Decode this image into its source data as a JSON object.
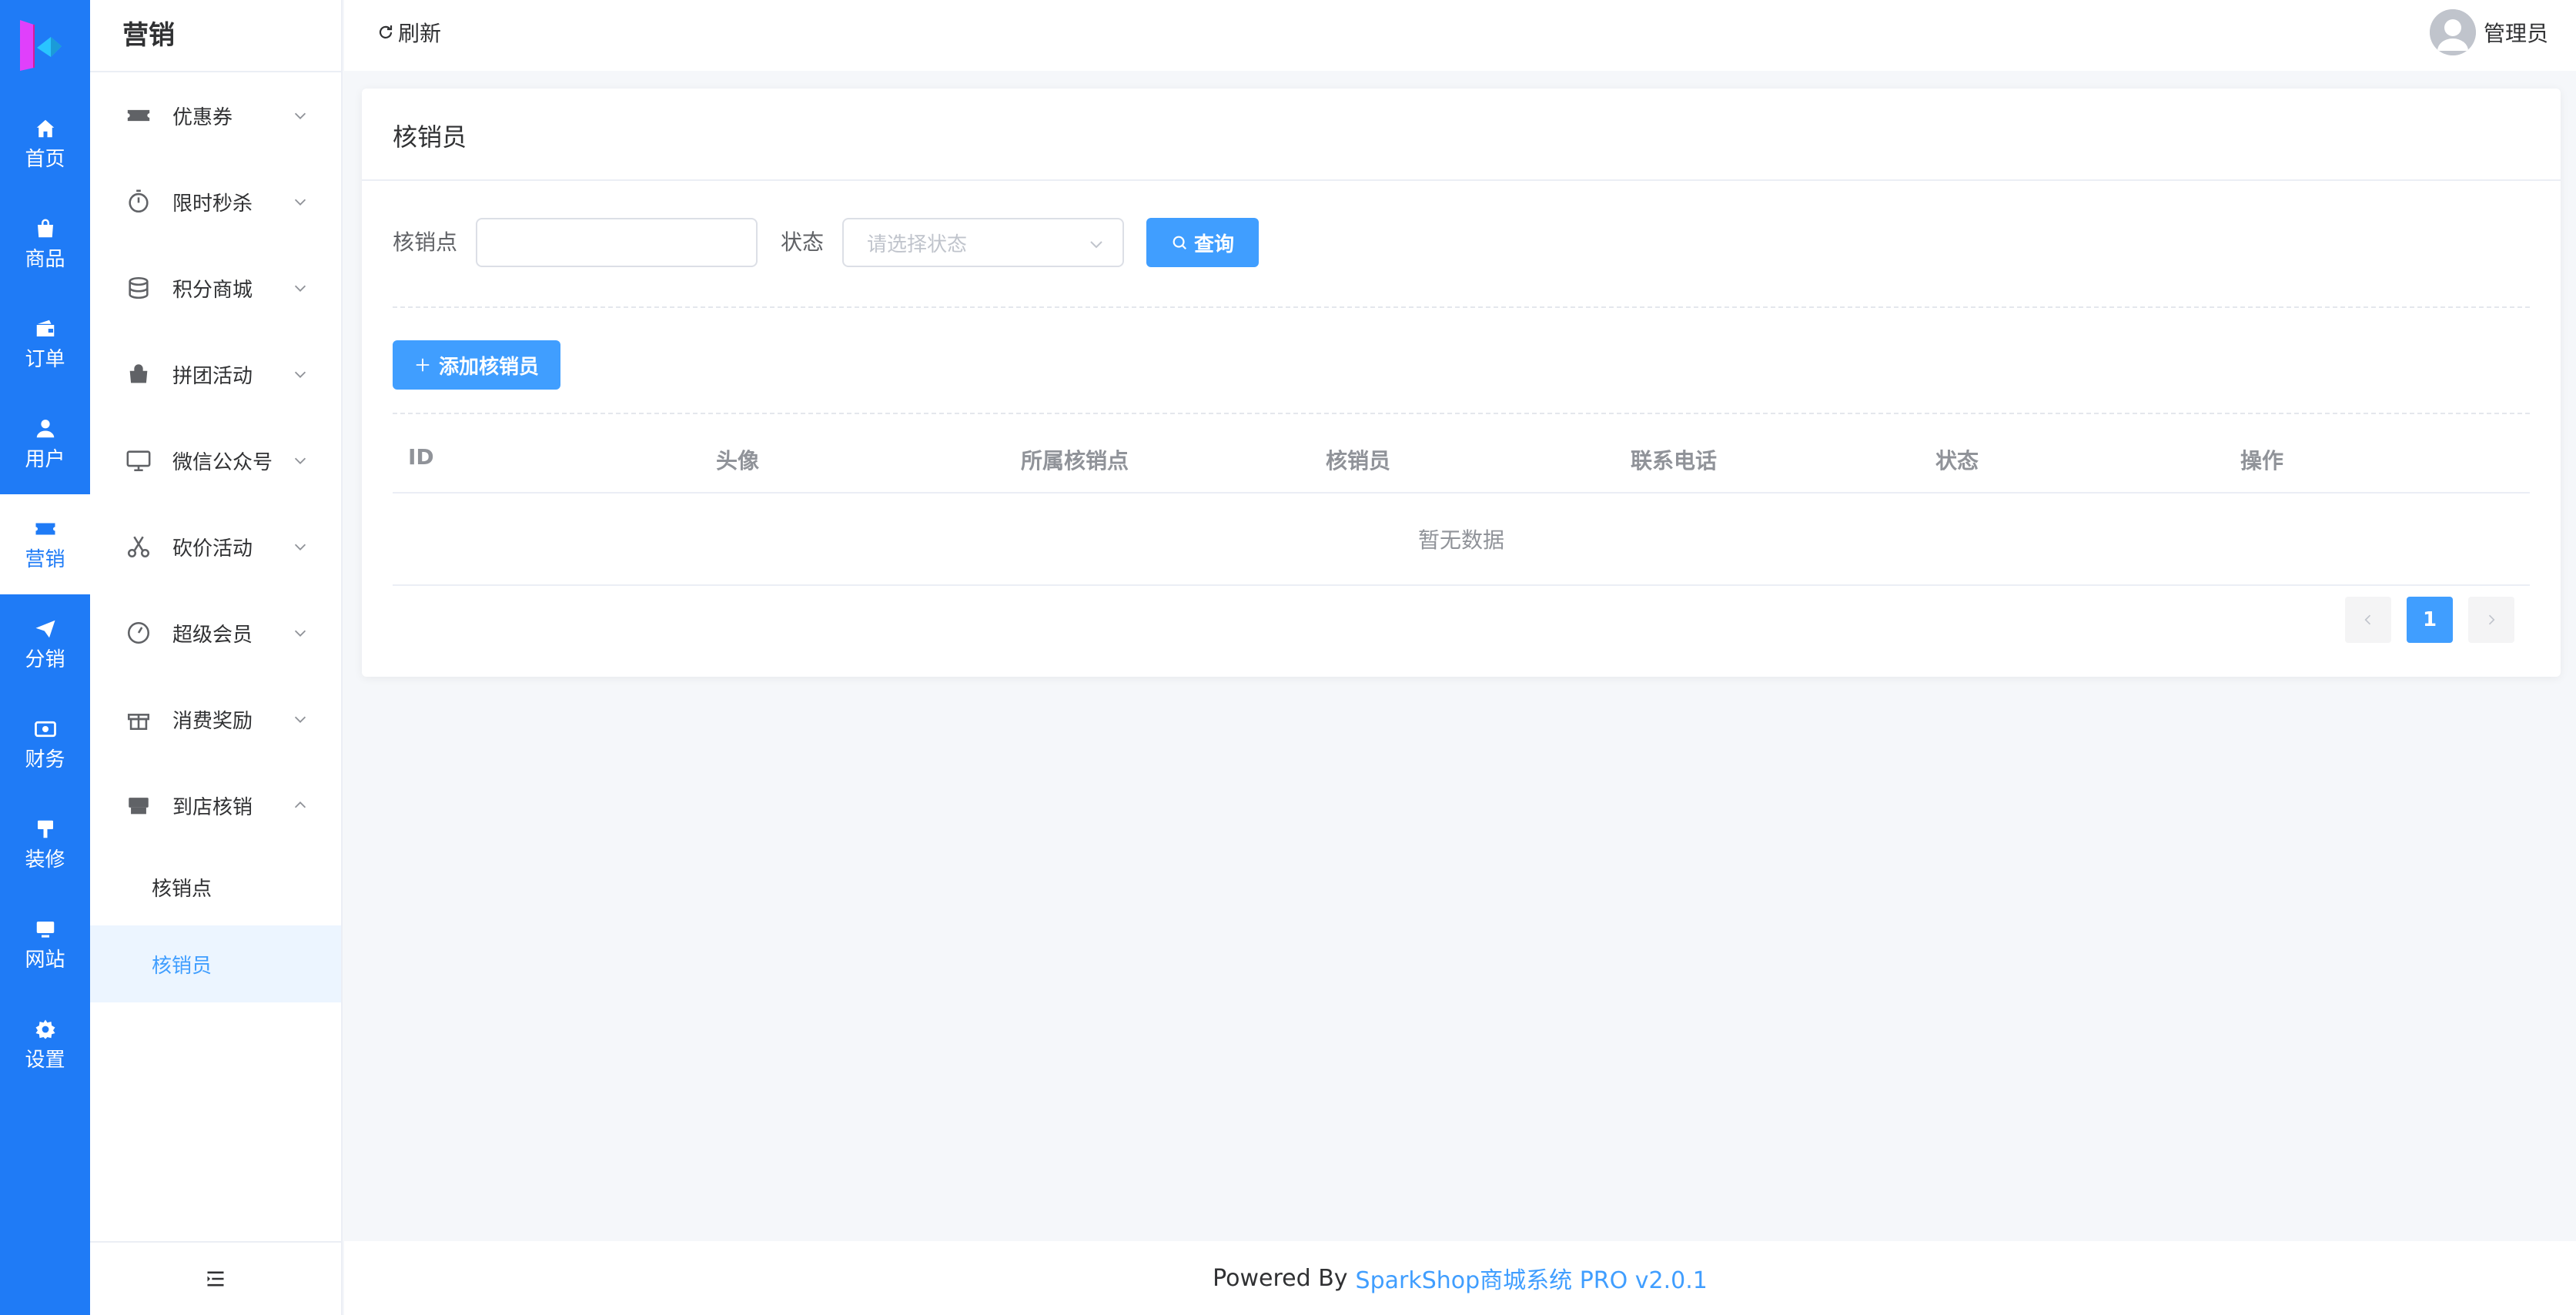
{
  "colors": {
    "primary_rail": "#1f7bf6",
    "accent": "#409eff",
    "active_bg": "#ecf5ff"
  },
  "rail": {
    "items": [
      {
        "label": "首页",
        "icon": "home-icon"
      },
      {
        "label": "商品",
        "icon": "bag-icon"
      },
      {
        "label": "订单",
        "icon": "wallet-icon"
      },
      {
        "label": "用户",
        "icon": "user-icon"
      },
      {
        "label": "营销",
        "icon": "ticket-icon",
        "active": true
      },
      {
        "label": "分销",
        "icon": "send-icon"
      },
      {
        "label": "财务",
        "icon": "money-icon"
      },
      {
        "label": "装修",
        "icon": "brush-icon"
      },
      {
        "label": "网站",
        "icon": "monitor-icon"
      },
      {
        "label": "设置",
        "icon": "gear-icon"
      }
    ]
  },
  "subnav": {
    "title": "营销",
    "items": [
      {
        "label": "优惠券",
        "icon": "ticket-icon",
        "expanded": false
      },
      {
        "label": "限时秒杀",
        "icon": "stopwatch-icon",
        "expanded": false
      },
      {
        "label": "积分商城",
        "icon": "coins-icon",
        "expanded": false
      },
      {
        "label": "拼团活动",
        "icon": "shopping-bag-icon",
        "expanded": false
      },
      {
        "label": "微信公众号",
        "icon": "monitor-icon",
        "expanded": false
      },
      {
        "label": "砍价活动",
        "icon": "scissors-icon",
        "expanded": false
      },
      {
        "label": "超级会员",
        "icon": "gauge-icon",
        "expanded": false
      },
      {
        "label": "消费奖励",
        "icon": "gift-icon",
        "expanded": false
      },
      {
        "label": "到店核销",
        "icon": "store-icon",
        "expanded": true
      }
    ],
    "children": [
      {
        "label": "核销点",
        "active": false
      },
      {
        "label": "核销员",
        "active": true
      }
    ]
  },
  "topbar": {
    "refresh_label": "刷新",
    "username": "管理员"
  },
  "main": {
    "title": "核销员",
    "filters": {
      "point_label": "核销点",
      "point_value": "",
      "status_label": "状态",
      "status_placeholder": "请选择状态",
      "search_label": "查询"
    },
    "add_button_label": "添加核销员",
    "table": {
      "columns": [
        "ID",
        "头像",
        "所属核销点",
        "核销员",
        "联系电话",
        "状态",
        "操作"
      ],
      "rows": [],
      "empty_text": "暂无数据"
    },
    "pagination": {
      "current_page": "1"
    }
  },
  "footer": {
    "prefix": "Powered By",
    "link_text": "SparkShop商城系统 PRO v2.0.1"
  }
}
